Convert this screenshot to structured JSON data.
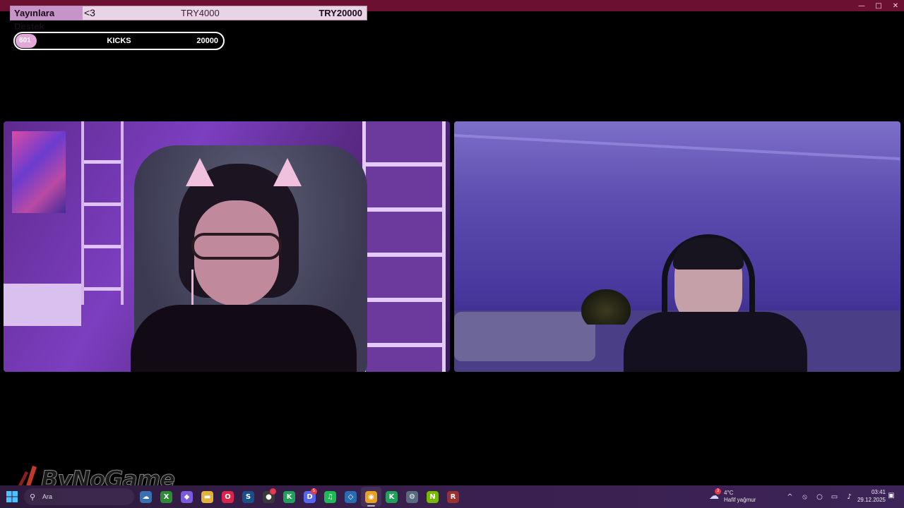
{
  "window": {
    "controls": {
      "minimize": "—",
      "maximize": "□",
      "close": "✕"
    }
  },
  "donation_goal": {
    "label": "Yayınlara Destek",
    "hearts": "<3",
    "current": "TRY4000",
    "target": "TRY20000",
    "progress_fraction": 0.2
  },
  "kicks_goal": {
    "count": "601",
    "title": "KICKS",
    "goal": "20000",
    "progress_fraction": 0.03
  },
  "logo": {
    "text": "ByNoGame"
  },
  "taskbar": {
    "search_placeholder": "Ara",
    "apps": [
      {
        "name": "widgets",
        "glyph": "☁",
        "color": "#3a6fb0"
      },
      {
        "name": "xbox",
        "glyph": "X",
        "color": "#2e8b35"
      },
      {
        "name": "copilot",
        "glyph": "◆",
        "color": "#7a5bd8"
      },
      {
        "name": "file-explorer",
        "glyph": "▬",
        "color": "#e0b33a"
      },
      {
        "name": "opera",
        "glyph": "O",
        "color": "#d8254a"
      },
      {
        "name": "steam",
        "glyph": "S",
        "color": "#1b4f8a"
      },
      {
        "name": "obs",
        "glyph": "●",
        "color": "#3a3a3a",
        "badge": ""
      },
      {
        "name": "kick",
        "glyph": "K",
        "color": "#22a05a"
      },
      {
        "name": "discord",
        "glyph": "D",
        "color": "#5865f2",
        "badge": "5"
      },
      {
        "name": "spotify",
        "glyph": "♫",
        "color": "#1db954"
      },
      {
        "name": "app-blue",
        "glyph": "◇",
        "color": "#2b6cb0"
      },
      {
        "name": "chrome",
        "glyph": "◉",
        "color": "#e8a020",
        "active": true
      },
      {
        "name": "kick-2",
        "glyph": "K",
        "color": "#22a05a"
      },
      {
        "name": "settings",
        "glyph": "⚙",
        "color": "#5a6b80"
      },
      {
        "name": "nvidia",
        "glyph": "N",
        "color": "#76b900"
      },
      {
        "name": "winrar",
        "glyph": "R",
        "color": "#9b3030"
      }
    ],
    "weather": {
      "temp": "4°C",
      "desc": "Hafif yağmur",
      "badge": "3"
    },
    "tray": {
      "chevron": "^",
      "network_off": "⦸",
      "mic": "○",
      "display": "▭",
      "volume": "♪"
    },
    "clock": {
      "time": "03:41",
      "date": "29.12.2025"
    },
    "notifications_icon": "▣"
  }
}
